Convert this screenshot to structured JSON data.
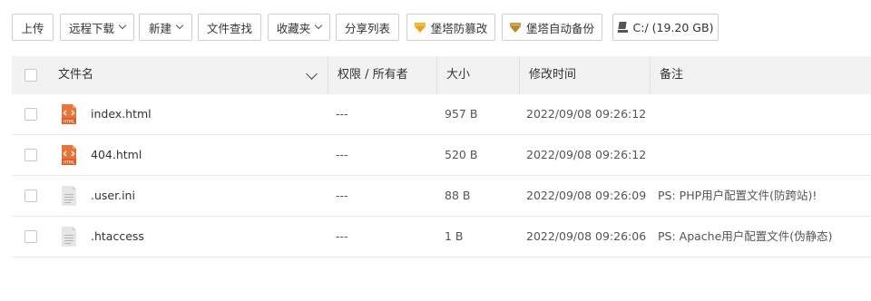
{
  "toolbar": {
    "upload": "上传",
    "remote_download": "远程下载",
    "new": "新建",
    "file_search": "文件查找",
    "favorites": "收藏夹",
    "share_list": "分享列表",
    "anti_tamper": "堡塔防篡改",
    "auto_backup": "堡塔自动备份",
    "disk": "C:/ (19.20 GB)"
  },
  "table": {
    "headers": {
      "name": "文件名",
      "permission": "权限 / 所有者",
      "size": "大小",
      "modified": "修改时间",
      "note": "备注"
    },
    "rows": [
      {
        "name": "index.html",
        "permission": "---",
        "size": "957 B",
        "modified": "2022/09/08 09:26:12",
        "note": "",
        "icon": "html-file-icon"
      },
      {
        "name": "404.html",
        "permission": "---",
        "size": "520 B",
        "modified": "2022/09/08 09:26:12",
        "note": "",
        "icon": "html-file-icon"
      },
      {
        "name": ".user.ini",
        "permission": "---",
        "size": "88 B",
        "modified": "2022/09/08 09:26:09",
        "note": "PS: PHP用户配置文件(防跨站)!",
        "icon": "text-file-icon"
      },
      {
        "name": ".htaccess",
        "permission": "---",
        "size": "1 B",
        "modified": "2022/09/08 09:26:06",
        "note": "PS: Apache用户配置文件(伪静态)",
        "icon": "text-file-icon"
      }
    ]
  },
  "colors": {
    "html_icon": "#e8743b",
    "gem_gold": "#f0a020",
    "header_bg": "#f2f2f2"
  }
}
